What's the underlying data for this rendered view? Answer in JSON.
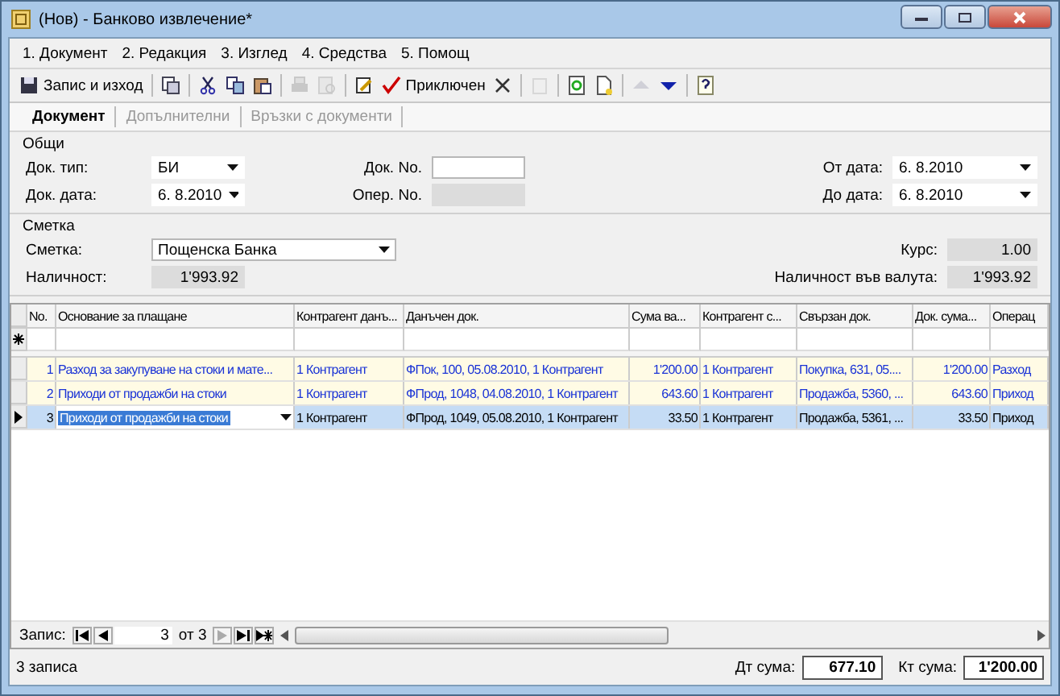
{
  "window": {
    "title": "(Нов) - Банково извлечение*"
  },
  "menu": [
    "1. Документ",
    "2. Редакция",
    "3. Изглед",
    "4. Средства",
    "5. Помощ"
  ],
  "toolbar": [
    {
      "kind": "save",
      "label": "Запис и изход",
      "disabled": false
    },
    {
      "kind": "copydoc",
      "disabled": false
    },
    {
      "kind": "cut",
      "disabled": false
    },
    {
      "kind": "copy",
      "disabled": false
    },
    {
      "kind": "paste",
      "disabled": false
    },
    {
      "kind": "print",
      "disabled": true
    },
    {
      "kind": "preview",
      "disabled": true
    },
    {
      "kind": "edit",
      "disabled": false
    },
    {
      "kind": "check",
      "label": "Приключен",
      "disabled": false
    },
    {
      "kind": "delete",
      "disabled": false
    },
    {
      "kind": "list",
      "disabled": true
    },
    {
      "kind": "refresh",
      "disabled": false
    },
    {
      "kind": "newdoc",
      "disabled": false
    },
    {
      "kind": "up",
      "disabled": true
    },
    {
      "kind": "down",
      "disabled": false
    },
    {
      "kind": "help",
      "disabled": false
    }
  ],
  "tabs": [
    {
      "label": "Документ",
      "selected": true
    },
    {
      "label": "Допълнителни",
      "selected": false
    },
    {
      "label": "Връзки с документи",
      "selected": false
    }
  ],
  "general": {
    "title": "Общи",
    "fields": [
      {
        "label": "Док. тип:",
        "kind": "dropdown",
        "value": "БИ",
        "disabled": false
      },
      {
        "label": "Док. No.",
        "kind": "text",
        "disabled": false
      },
      {
        "label": "От дата:",
        "kind": "dropdown",
        "value": "6. 8.2010",
        "disabled": false
      },
      {
        "label": "Док. дата:",
        "kind": "dropdown",
        "value": "6. 8.2010",
        "disabled": false
      },
      {
        "label": "Опер. No.",
        "kind": "text",
        "disabled": true
      },
      {
        "label": "До дата:",
        "kind": "dropdown",
        "value": "6. 8.2010",
        "disabled": false
      }
    ]
  },
  "account": {
    "title": "Сметка",
    "account": {
      "label": "Сметка:",
      "value": "Пощенска Банка"
    },
    "rate": {
      "label": "Курс:",
      "value": "1.00"
    },
    "balance": {
      "label": "Наличност:",
      "value": "1'993.92"
    },
    "balance_currency": {
      "label": "Наличност във валута:",
      "value": "1'993.92"
    }
  },
  "table": {
    "columns": [
      "No.",
      "Основание за плащане",
      "Контрагент данъ...",
      "Данъчен док.",
      "Сума ва...",
      "Контрагент с...",
      "Свързан док.",
      "Док. сума...",
      "Операц"
    ],
    "rows": [
      {
        "selected": false,
        "cells": [
          "1",
          "Разход за закупуване на стоки и мате...",
          "1 Контрагент",
          "ФПок, 100, 05.08.2010, 1 Контрагент",
          "1'200.00",
          "1 Контрагент",
          "Покупка, 631, 05....",
          "1'200.00",
          "Разход"
        ]
      },
      {
        "selected": false,
        "cells": [
          "2",
          "Приходи от продажби на стоки",
          "1 Контрагент",
          "ФПрод, 1048, 04.08.2010, 1 Контрагент",
          "643.60",
          "1 Контрагент",
          "Продажба, 5360, ...",
          "643.60",
          "Приход"
        ]
      },
      {
        "selected": true,
        "cells": [
          "3",
          "Приходи от продажби на стоки",
          "1 Контрагент",
          "ФПрод, 1049, 05.08.2010, 1 Контрагент",
          "33.50",
          "1 Контрагент",
          "Продажба, 5361, ...",
          "33.50",
          "Приход"
        ]
      }
    ]
  },
  "navigator": {
    "label": "Запис:",
    "current": "3",
    "of": "от 3"
  },
  "status": {
    "text": "3 записа",
    "debit_label": "Дт сума:",
    "debit": "677.10",
    "credit_label": "Кт сума:",
    "credit": "1'200.00"
  }
}
